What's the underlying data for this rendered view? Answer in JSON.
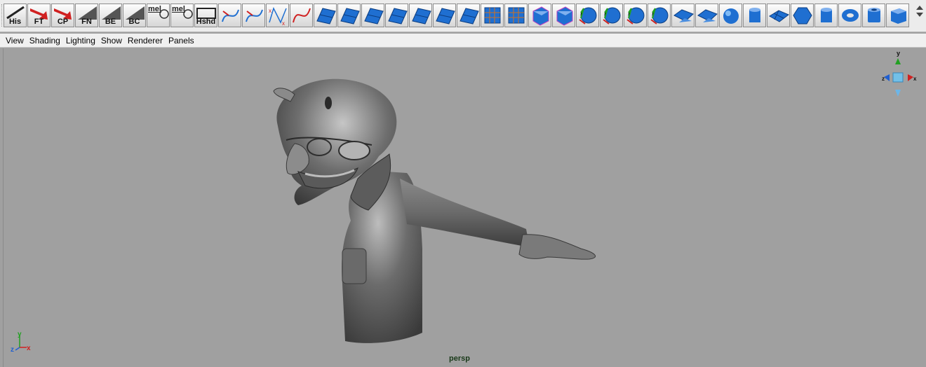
{
  "shelf": {
    "buttons": [
      {
        "label": "His",
        "icon": "brush-icon"
      },
      {
        "label": "FT",
        "icon": "red-arrow-icon"
      },
      {
        "label": "CP",
        "icon": "red-arrow-icon"
      },
      {
        "label": "FN",
        "icon": "diagonal-icon"
      },
      {
        "label": "BE",
        "icon": "diagonal-icon"
      },
      {
        "label": "BC",
        "icon": "diagonal-icon"
      },
      {
        "label": "mel",
        "icon": "mel-script-icon"
      },
      {
        "label": "mel",
        "icon": "mel-script-icon"
      },
      {
        "label": "Hshd",
        "icon": "hypershade-icon"
      },
      {
        "label": "",
        "icon": "curve-tool-icon"
      },
      {
        "label": "",
        "icon": "curve-tool-icon"
      },
      {
        "label": "",
        "icon": "cv-curve-icon"
      },
      {
        "label": "",
        "icon": "ep-curve-icon"
      },
      {
        "label": "",
        "icon": "nurbs-surface-icon"
      },
      {
        "label": "",
        "icon": "nurbs-surface-icon"
      },
      {
        "label": "",
        "icon": "nurbs-surface-icon"
      },
      {
        "label": "",
        "icon": "nurbs-surface-icon"
      },
      {
        "label": "",
        "icon": "nurbs-surface-icon"
      },
      {
        "label": "",
        "icon": "nurbs-surface-icon"
      },
      {
        "label": "",
        "icon": "nurbs-surface-icon"
      },
      {
        "label": "",
        "icon": "poly-grid-icon"
      },
      {
        "label": "",
        "icon": "poly-grid-icon"
      },
      {
        "label": "",
        "icon": "poly-cube-icon"
      },
      {
        "label": "",
        "icon": "poly-cube-icon"
      },
      {
        "label": "",
        "icon": "poly-sphere-icon"
      },
      {
        "label": "",
        "icon": "poly-sphere-icon"
      },
      {
        "label": "",
        "icon": "poly-sphere-icon"
      },
      {
        "label": "",
        "icon": "poly-sphere-icon"
      },
      {
        "label": "",
        "icon": "poly-plane-icon"
      },
      {
        "label": "",
        "icon": "poly-plane-icon"
      },
      {
        "label": "",
        "icon": "sphere-icon"
      },
      {
        "label": "",
        "icon": "cylinder-icon"
      },
      {
        "label": "",
        "icon": "plane-icon"
      },
      {
        "label": "",
        "icon": "soccer-ball-icon"
      },
      {
        "label": "",
        "icon": "cylinder-icon"
      },
      {
        "label": "",
        "icon": "torus-icon"
      },
      {
        "label": "",
        "icon": "pipe-icon"
      },
      {
        "label": "",
        "icon": "cube-icon"
      }
    ]
  },
  "menu": [
    "View",
    "Shading",
    "Lighting",
    "Show",
    "Renderer",
    "Panels"
  ],
  "viewport": {
    "camera": "persp",
    "axis_labels": {
      "x": "x",
      "y": "y",
      "z": "z"
    }
  },
  "colors": {
    "blue": "#1f6fd1",
    "red": "#d02020",
    "green": "#22a022"
  }
}
